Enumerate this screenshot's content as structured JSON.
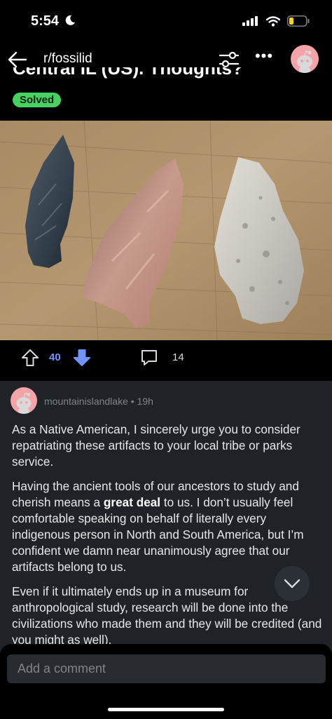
{
  "status_bar": {
    "time": "5:54"
  },
  "nav": {
    "community": "r/fossilid",
    "more_label": "•••"
  },
  "post": {
    "title_fragment": "Central IL (US). Thoughts?",
    "flair": "Solved",
    "votes": "40",
    "comments": "14"
  },
  "comment": {
    "author_meta": "mountainislandlake • 19h",
    "paragraph1": "As a Native American, I sincerely urge you to consider repatriating these artifacts to your local tribe or parks service.",
    "paragraph2_before": "Having the ancient tools of our ancestors to study and cherish means a ",
    "paragraph2_bold": "great deal",
    "paragraph2_after": " to us. I don’t usually feel comfortable speaking on behalf of literally every indigenous person in North and South America, but I’m confident we damn near unanimously agree that our artifacts belong to us.",
    "paragraph3": "Even if it ultimately ends up in a museum for anthropological study, research will be done into the civilizations who made them and they will be credited (and you might as well)."
  },
  "composer": {
    "placeholder": "Add a comment"
  },
  "colors": {
    "accent_blue": "#7193ff",
    "flair_green": "#46d160",
    "avatar_pink": "#f4a4a8"
  },
  "icons": [
    "moon-icon",
    "signal-icon",
    "wifi-icon",
    "battery-icon",
    "back-arrow-icon",
    "filter-icon",
    "more-icon",
    "upvote-icon",
    "downvote-icon",
    "comment-icon",
    "chevron-down-icon"
  ]
}
